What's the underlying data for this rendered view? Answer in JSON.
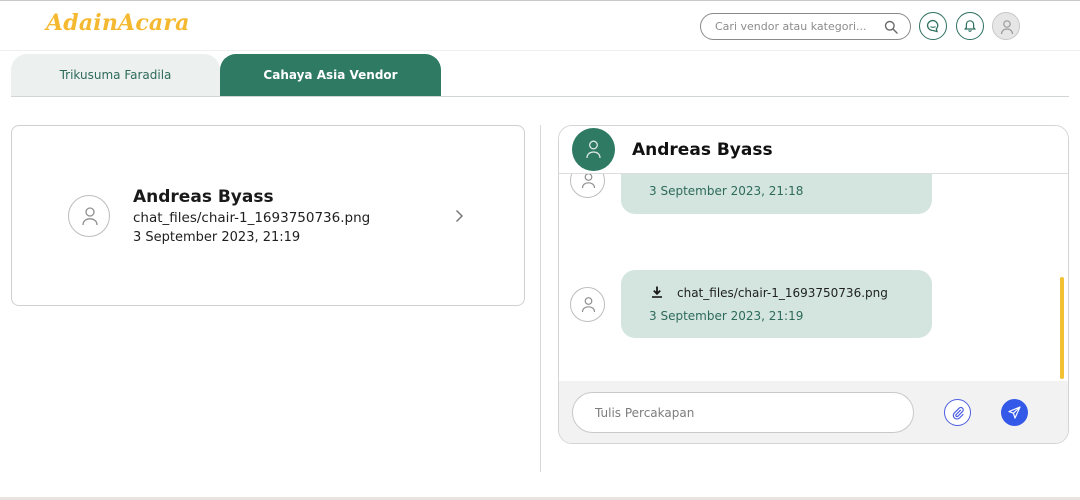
{
  "brand": {
    "logo_text": "AdainAcara",
    "accent": "#f5b931",
    "primary": "#2e7a62"
  },
  "header": {
    "search": {
      "placeholder": "Cari vendor atau kategori..."
    },
    "icons": [
      "search-icon",
      "chat-icon",
      "bell-icon",
      "user-icon"
    ]
  },
  "tabs": [
    {
      "label": "Trikusuma Faradila",
      "active": false
    },
    {
      "label": "Cahaya Asia Vendor",
      "active": true
    }
  ],
  "chat_list": [
    {
      "name": "Andreas Byass",
      "last_message": "chat_files/chair-1_1693750736.png",
      "time": "3 September 2023, 21:19"
    }
  ],
  "conversation": {
    "contact_name": "Andreas Byass",
    "messages": [
      {
        "time": "3 September 2023, 21:18"
      },
      {
        "file": "chat_files/chair-1_1693750736.png",
        "time": "3 September 2023, 21:19"
      }
    ],
    "composer": {
      "placeholder": "Tulis Percakapan"
    }
  }
}
